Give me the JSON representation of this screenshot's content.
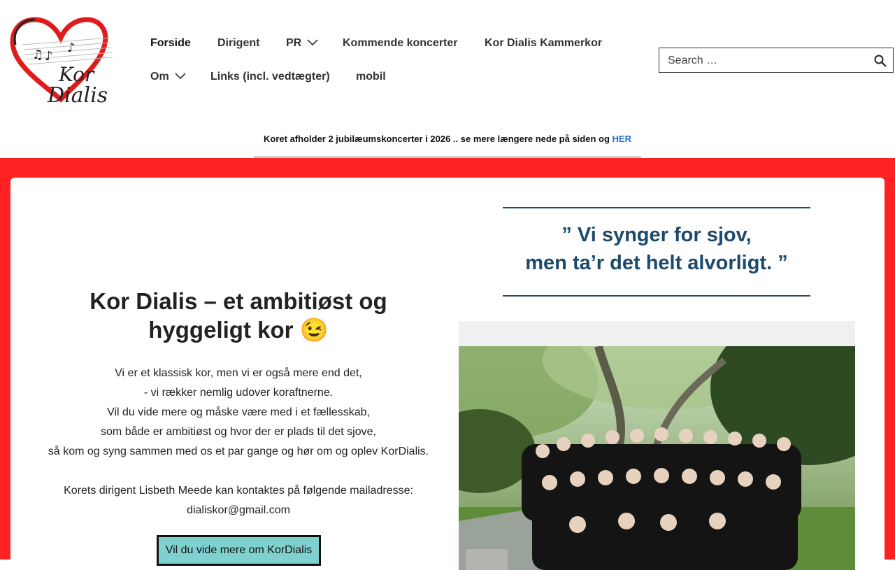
{
  "header": {
    "logo": {
      "line1": "Kor",
      "line2": "Dialis",
      "icon": "heart-music-logo"
    },
    "nav": [
      {
        "label": "Forside",
        "active": true
      },
      {
        "label": "Dirigent"
      },
      {
        "label": "PR",
        "dropdown": true
      },
      {
        "label": "Kommende koncerter"
      },
      {
        "label": "Kor Dialis Kammerkor"
      },
      {
        "label": "Om",
        "dropdown": true
      },
      {
        "label": "Links (incl. vedtægter)"
      },
      {
        "label": "mobil"
      }
    ],
    "search": {
      "placeholder": "Search …",
      "icon": "search-icon"
    }
  },
  "announcement": {
    "text": "Koret afholder 2 jubilæumskoncerter i 2026 .. se mere længere nede på siden og ",
    "link": "HER"
  },
  "main": {
    "headline": "Kor Dialis – et ambitiøst og hyggeligt kor 😉",
    "paragraphs": [
      "Vi er et klassisk kor, men vi er også mere end det,",
      "- vi rækker nemlig udover koraftnerne.",
      "Vil du vide mere og måske være med i et fællesskab,",
      "som både er ambitiøst og hvor der er plads til det sjove,",
      "så kom og syng sammen med os et par gange og hør om og oplev KorDialis."
    ],
    "contact_line": "Korets dirigent Lisbeth Meede kan kontaktes på følgende mailadresse:",
    "email": "dialiskor@gmail.com",
    "cta": "Vil du vide mere om KorDialis",
    "quote_line1": "” Vi synger for sjov,",
    "quote_line2": "men ta’r det helt alvorligt. ”"
  },
  "colors": {
    "accent_red": "#ff2222",
    "button_teal": "#7fd1cf",
    "quote_blue": "#1c4a6b",
    "link_blue": "#1a6ad6"
  }
}
